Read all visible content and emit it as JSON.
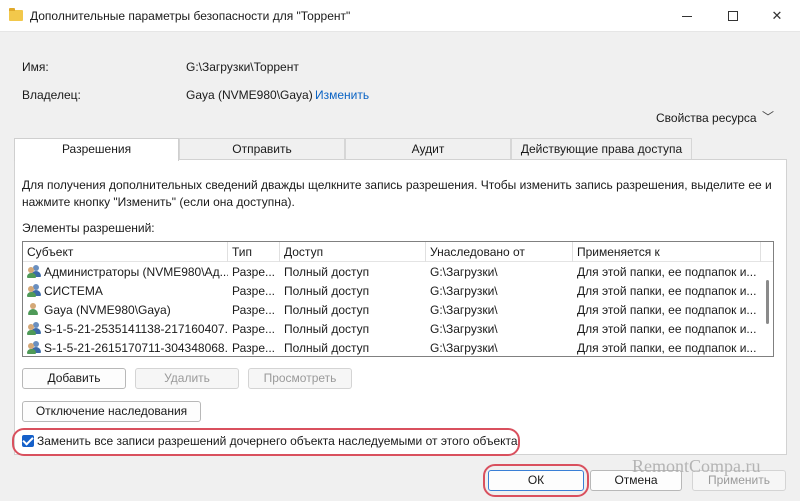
{
  "window": {
    "title": "Дополнительные параметры безопасности  для \"Торрент\"",
    "icon": "folder-icon"
  },
  "info": {
    "name_label": "Имя:",
    "name_value": "G:\\Загрузки\\Торрент",
    "owner_label": "Владелец:",
    "owner_value": "Gaya (NVME980\\Gaya)",
    "change_link": "Изменить",
    "resource_props": "Свойства ресурса"
  },
  "tabs": [
    {
      "label": "Разрешения",
      "active": true
    },
    {
      "label": "Отправить",
      "active": false
    },
    {
      "label": "Аудит",
      "active": false
    },
    {
      "label": "Действующие права доступа",
      "active": false
    }
  ],
  "hint": "Для получения дополнительных сведений дважды щелкните запись разрешения. Чтобы изменить запись разрешения, выделите ее и нажмите кнопку \"Изменить\" (если она доступна).",
  "entries_label": "Элементы разрешений:",
  "columns": [
    "Субъект",
    "Тип",
    "Доступ",
    "Унаследовано от",
    "Применяется к"
  ],
  "rows": [
    {
      "subject": "Администраторы (NVME980\\Ад...",
      "type": "Разре...",
      "access": "Полный доступ",
      "inherited": "G:\\Загрузки\\",
      "applies": "Для этой папки, ее подпапок и..."
    },
    {
      "subject": "СИСТЕМА",
      "type": "Разре...",
      "access": "Полный доступ",
      "inherited": "G:\\Загрузки\\",
      "applies": "Для этой папки, ее подпапок и..."
    },
    {
      "subject": "Gaya (NVME980\\Gaya)",
      "type": "Разре...",
      "access": "Полный доступ",
      "inherited": "G:\\Загрузки\\",
      "applies": "Для этой папки, ее подпапок и..."
    },
    {
      "subject": "S-1-5-21-2535141138-217160407...",
      "type": "Разре...",
      "access": "Полный доступ",
      "inherited": "G:\\Загрузки\\",
      "applies": "Для этой папки, ее подпапок и..."
    },
    {
      "subject": "S-1-5-21-2615170711-304348068...",
      "type": "Разре...",
      "access": "Полный доступ",
      "inherited": "G:\\Загрузки\\",
      "applies": "Для этой папки, ее подпапок и..."
    }
  ],
  "buttons": {
    "add": "Добавить",
    "remove": "Удалить",
    "view": "Просмотреть",
    "disable_inheritance": "Отключение наследования",
    "ok": "ОК",
    "cancel": "Отмена",
    "apply": "Применить"
  },
  "replace_checkbox": {
    "label": "Заменить все записи разрешений дочернего объекта наследуемыми от этого объекта",
    "checked": true
  },
  "watermark": "RemontCompa.ru",
  "colors": {
    "highlight": "#d9505e",
    "accent": "#1560c9",
    "link": "#0a63c4"
  }
}
